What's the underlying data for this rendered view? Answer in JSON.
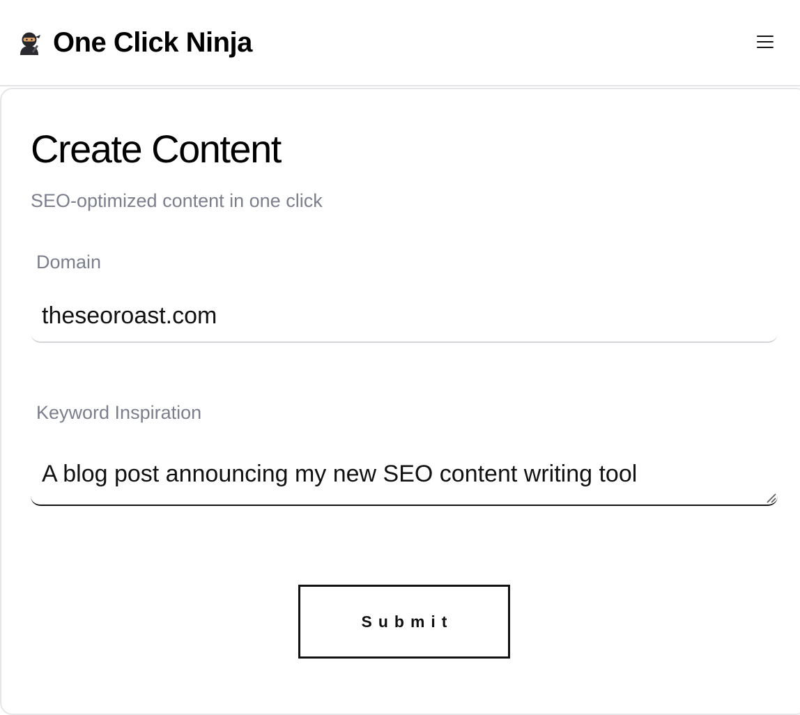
{
  "header": {
    "brand_icon": "ninja-emoji-icon",
    "brand_name": "One Click Ninja",
    "menu_icon": "hamburger-menu-icon"
  },
  "form": {
    "title": "Create Content",
    "subtitle": "SEO-optimized content in one click",
    "domain": {
      "label": "Domain",
      "value": "theseoroast.com"
    },
    "keyword": {
      "label": "Keyword Inspiration",
      "value": "A blog post announcing my new SEO content writing tool"
    },
    "submit_label": "Submit"
  }
}
